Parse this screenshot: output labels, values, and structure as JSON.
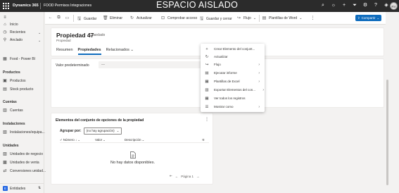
{
  "topbar": {
    "app_name": "Dynamics 365",
    "module": "FOOD Permisos Integraciones",
    "environment": "ESPACIO AISLADO",
    "avatar": "RV",
    "icons": [
      "search-icon",
      "lightbulb-icon",
      "plus-icon",
      "filter-icon",
      "gear-icon",
      "help-icon",
      "copilot-icon"
    ]
  },
  "sidebar": {
    "top_items": [
      {
        "label": "Inicio",
        "icon": "home-icon"
      },
      {
        "label": "Recientes",
        "icon": "clock-icon"
      },
      {
        "label": "Anclado",
        "icon": "pin-icon"
      }
    ],
    "app_label": "Food - Power BI",
    "sections": [
      {
        "title": "Productos",
        "items": [
          {
            "label": "Productos"
          },
          {
            "label": "Stock producto"
          }
        ]
      },
      {
        "title": "Cuentas",
        "items": [
          {
            "label": "Cuentas"
          }
        ]
      },
      {
        "title": "Instalaciones",
        "items": [
          {
            "label": "Instalaciones/equipa..."
          }
        ]
      },
      {
        "title": "Unidades",
        "items": [
          {
            "label": "Unidades de negocio"
          },
          {
            "label": "Unidades de venta"
          },
          {
            "label": "Conversiones unidad..."
          }
        ]
      }
    ],
    "bottom": {
      "badge": "E",
      "label": "Entidades"
    }
  },
  "commandbar": {
    "save": "Guardar",
    "delete": "Eliminar",
    "refresh": "Actualizar",
    "check_access": "Comprobar acceso",
    "save_close": "Guardar y cerrar",
    "flow": "Flujo",
    "word_templates": "Plantillas de Word",
    "share": "Compartir"
  },
  "record": {
    "title": "Propiedad 47",
    "saved_status": "- Guardado",
    "entity": "Propiedad",
    "tabs": [
      "Resumen",
      "Propiedades",
      "Relacionados"
    ],
    "active_tab": 1
  },
  "form": {
    "field_label": "Valor predeterminado",
    "field_value": "---"
  },
  "subgrid": {
    "title": "Elementos del conjunto de opciones de la propiedad",
    "group_label": "Agrupar por:",
    "group_value": "(no hay agrupación)",
    "columns": [
      "Número ↓",
      "Valor",
      "Descripción"
    ],
    "empty_text": "No hay datos disponibles.",
    "page_label": "Página 1"
  },
  "menu": {
    "items": [
      {
        "label": "Crear Elemento del conjunt...",
        "icon": "plus-icon",
        "submenu": false
      },
      {
        "label": "Actualizar",
        "icon": "refresh-icon",
        "submenu": false
      },
      {
        "label": "Flujo",
        "icon": "flow-icon",
        "submenu": true
      },
      {
        "label": "Ejecutar informe",
        "icon": "report-icon",
        "submenu": true
      },
      {
        "label": "Plantillas de Excel",
        "icon": "excel-icon",
        "submenu": true
      },
      {
        "label": "Exportar Elementos del con...",
        "icon": "export-icon",
        "submenu": true
      },
      {
        "label": "Ver todos los registros",
        "icon": "grid-icon",
        "submenu": false
      },
      {
        "label": "Mostrar como",
        "icon": "view-icon",
        "submenu": true
      }
    ]
  }
}
